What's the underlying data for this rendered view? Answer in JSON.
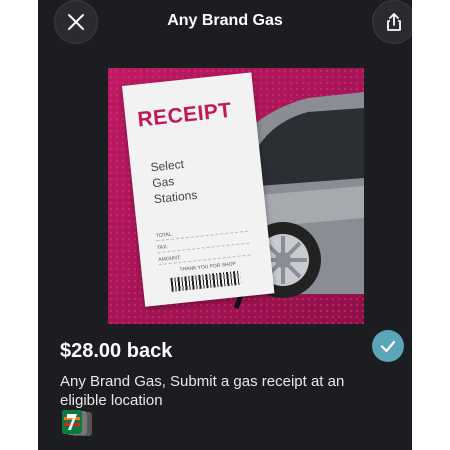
{
  "header": {
    "title": "Any Brand Gas",
    "close_icon": "close-icon",
    "share_icon": "share-icon"
  },
  "hero": {
    "receipt_title": "RECEIPT",
    "receipt_body": "Select\nGas\nStations",
    "receipt_fields": [
      "TOTAL:",
      "TAX:",
      "AMOUNT:"
    ],
    "receipt_footer": "THANK YOU FOR SHOP",
    "background_color": "#b0175b",
    "receipt_title_color": "#c21759"
  },
  "offer": {
    "cashback": "$28.00 back",
    "description": "Any Brand Gas, Submit a gas receipt at an eligible location",
    "selected_icon": "check-icon",
    "selected_color": "#5aa5b8",
    "brand_logo": "7-eleven-logo"
  }
}
